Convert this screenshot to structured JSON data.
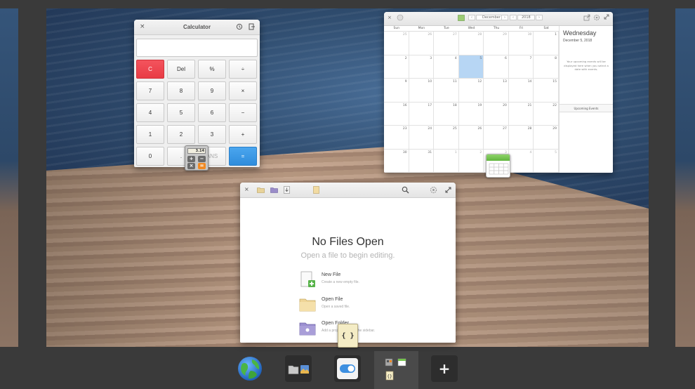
{
  "calculator": {
    "title": "Calculator",
    "close": "×",
    "history_icon": "history-icon",
    "extend_icon": "extend-icon",
    "keys": [
      "C",
      "Del",
      "%",
      "÷",
      "7",
      "8",
      "9",
      "×",
      "4",
      "5",
      "6",
      "−",
      "1",
      "2",
      "3",
      "+",
      "0",
      ".",
      "ANS",
      "="
    ],
    "app_icon_display": "3.14"
  },
  "calendar": {
    "back": "‹",
    "month": "December",
    "year": "2018",
    "weekdays": [
      "Sun",
      "Mon",
      "Tue",
      "Wed",
      "Thu",
      "Fri",
      "Sat"
    ],
    "weeks": [
      [
        "25",
        "26",
        "27",
        "28",
        "29",
        "30",
        "1"
      ],
      [
        "2",
        "3",
        "4",
        "5",
        "6",
        "7",
        "8"
      ],
      [
        "9",
        "10",
        "11",
        "12",
        "13",
        "14",
        "15"
      ],
      [
        "16",
        "17",
        "18",
        "19",
        "20",
        "21",
        "22"
      ],
      [
        "23",
        "24",
        "25",
        "26",
        "27",
        "28",
        "29"
      ],
      [
        "30",
        "31",
        "1",
        "2",
        "3",
        "4",
        "5"
      ]
    ],
    "side_day": "Wednesday",
    "side_date": "December  5, 2018",
    "side_note": "Your upcoming events will be displayed here when you select a date with events.",
    "upcoming_label": "Upcoming Events"
  },
  "editor": {
    "close": "×",
    "title": "No Files Open",
    "subtitle": "Open a file to begin editing.",
    "actions": [
      {
        "label": "New File",
        "desc": "Create a new empty file."
      },
      {
        "label": "Open File",
        "desc": "Open a saved file."
      },
      {
        "label": "Open Folder",
        "desc": "Add a project folder to the sidebar."
      }
    ],
    "app_icon_glyph": "{ }"
  },
  "dock": {
    "add": "+"
  },
  "colors": {
    "accent_blue": "#2f8ddc",
    "clear_red": "#e83c45",
    "today": "#b7d6f4",
    "dock_bg": "#3a3a3a"
  }
}
